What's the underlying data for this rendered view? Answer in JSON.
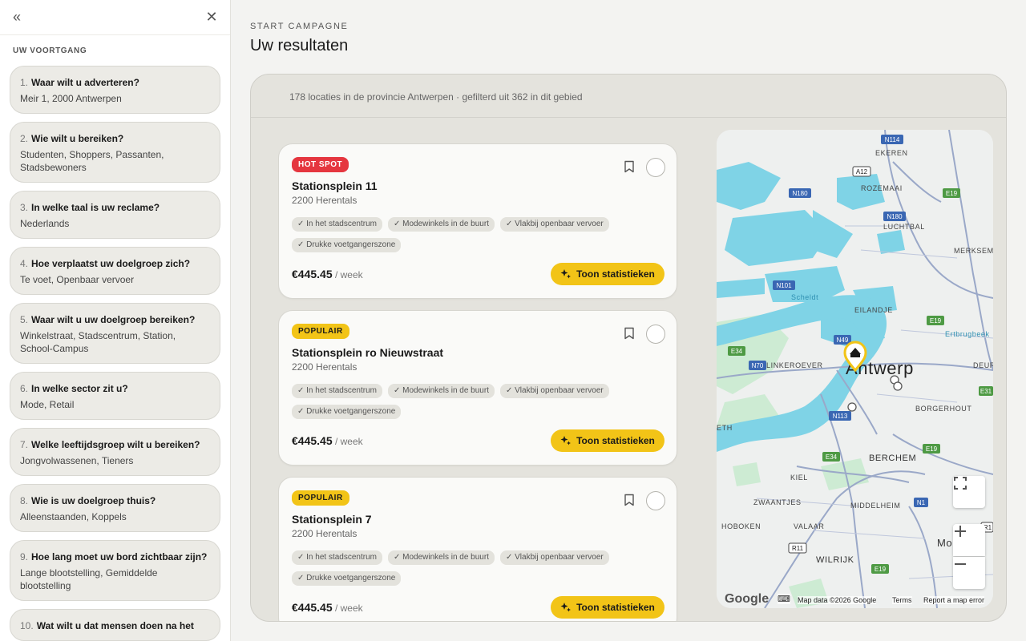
{
  "sidebar": {
    "heading": "UW VOORTGANG",
    "steps": [
      {
        "num": "1.",
        "question": "Waar wilt u adverteren?",
        "answer": "Meir 1, 2000 Antwerpen"
      },
      {
        "num": "2.",
        "question": "Wie wilt u bereiken?",
        "answer": "Studenten, Shoppers, Passanten, Stadsbewoners"
      },
      {
        "num": "3.",
        "question": "In welke taal is uw reclame?",
        "answer": "Nederlands"
      },
      {
        "num": "4.",
        "question": "Hoe verplaatst uw doelgroep zich?",
        "answer": "Te voet, Openbaar vervoer"
      },
      {
        "num": "5.",
        "question": "Waar wilt u uw doelgroep bereiken?",
        "answer": "Winkelstraat, Stadscentrum, Station, School-Campus"
      },
      {
        "num": "6.",
        "question": "In welke sector zit u?",
        "answer": "Mode, Retail"
      },
      {
        "num": "7.",
        "question": "Welke leeftijdsgroep wilt u bereiken?",
        "answer": "Jongvolwassenen, Tieners"
      },
      {
        "num": "8.",
        "question": "Wie is uw doelgroep thuis?",
        "answer": "Alleenstaanden, Koppels"
      },
      {
        "num": "9.",
        "question": "Hoe lang moet uw bord zichtbaar zijn?",
        "answer": "Lange blootstelling, Gemiddelde blootstelling"
      },
      {
        "num": "10.",
        "question": "Wat wilt u dat mensen doen na het",
        "answer": ""
      }
    ]
  },
  "main": {
    "eyebrow": "START CAMPAGNE",
    "title": "Uw resultaten",
    "summary": "178 locaties in de provincie Antwerpen · gefilterd uit 362 in dit gebied",
    "cards": [
      {
        "badge": "HOT SPOT",
        "badge_type": "hot",
        "name": "Stationsplein 11",
        "city": "2200 Herentals",
        "tags": [
          "✓ In het stadscentrum",
          "✓ Modewinkels in de buurt",
          "✓ Vlakbij openbaar vervoer",
          "✓ Drukke voetgangerszone"
        ],
        "price": "€445.45",
        "unit": " / week",
        "button": "Toon statistieken"
      },
      {
        "badge": "POPULAIR",
        "badge_type": "pop",
        "name": "Stationsplein ro Nieuwstraat",
        "city": "2200 Herentals",
        "tags": [
          "✓ In het stadscentrum",
          "✓ Modewinkels in de buurt",
          "✓ Vlakbij openbaar vervoer",
          "✓ Drukke voetgangerszone"
        ],
        "price": "€445.45",
        "unit": " / week",
        "button": "Toon statistieken"
      },
      {
        "badge": "POPULAIR",
        "badge_type": "pop",
        "name": "Stationsplein 7",
        "city": "2200 Herentals",
        "tags": [
          "✓ In het stadscentrum",
          "✓ Modewinkels in de buurt",
          "✓ Vlakbij openbaar vervoer",
          "✓ Drukke voetgangerszone"
        ],
        "price": "€445.45",
        "unit": " / week",
        "button": "Toon statistieken"
      }
    ]
  },
  "map": {
    "city_label": "Antwerp",
    "places": [
      "EKEREN",
      "ROZEMAAI",
      "LUCHTBAL",
      "MERKSEM",
      "Scheldt",
      "EILANDJE",
      "Ertbrugbeek",
      "LINKEROEVER",
      "DEUR",
      "BORGERHOUT",
      "BERCHEM",
      "KIEL",
      "ZWAANTJES",
      "MIDDELHEIM",
      "HOBOKEN",
      "VALAAR",
      "WILRIJK",
      "Mo",
      "ETH"
    ],
    "roads": [
      "N114",
      "A12",
      "N180",
      "E19",
      "N180",
      "N101",
      "N49",
      "E34",
      "N70",
      "E19",
      "E31",
      "N113",
      "E34",
      "E19",
      "N1",
      "R11",
      "E19",
      "R1"
    ],
    "footer": {
      "logo": "Google",
      "data": "Map data ©2026 Google",
      "terms": "Terms",
      "report": "Report a map error"
    },
    "colors": {
      "water": "#7fd3e6",
      "park": "#cdebd3",
      "road": "#9aa8c8",
      "land": "#eef0ef",
      "accent": "#f2c417"
    }
  }
}
